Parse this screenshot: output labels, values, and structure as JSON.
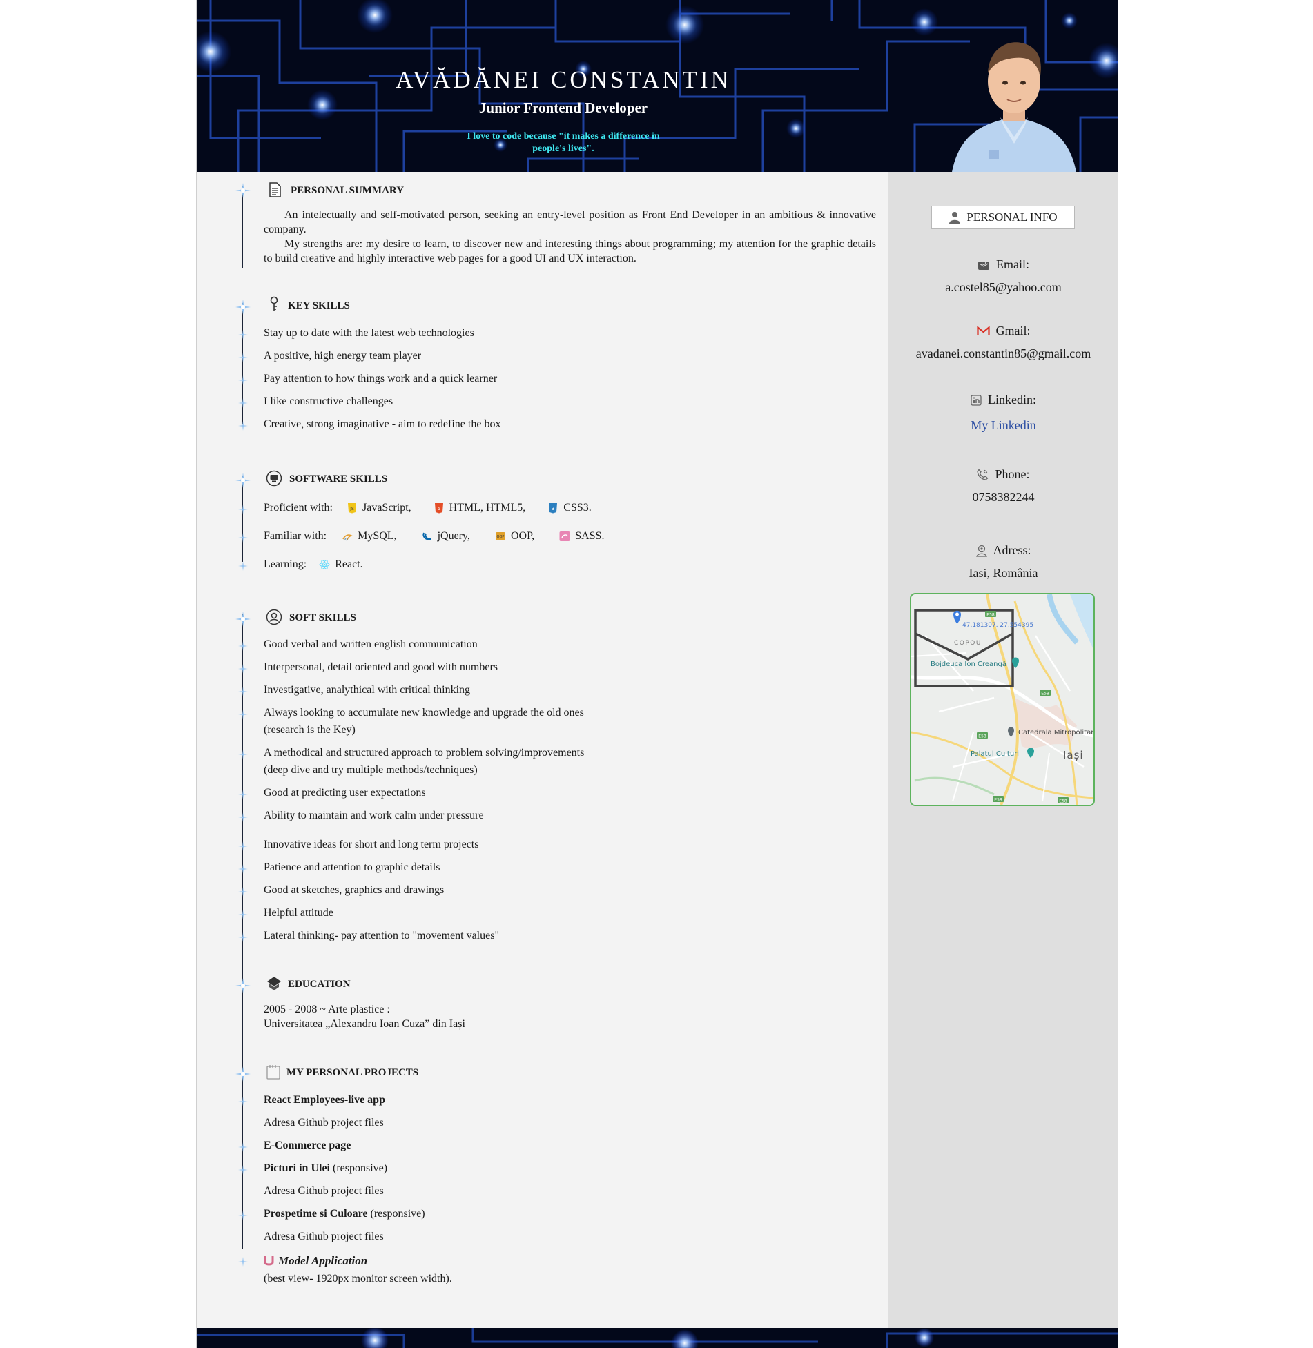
{
  "header": {
    "name": "AVĂDĂNEI CONSTANTIN",
    "role": "Junior Frontend Developer",
    "quote": "I love to code because \"it makes a difference in people's lives\"."
  },
  "summary": {
    "title": "PERSONAL SUMMARY",
    "paragraphs": [
      "An intelectually and self-motivated person, seeking an entry-level position as Front End Developer in an ambitious & innovative company.",
      "My strengths are: my desire to learn, to discover new and interesting things about programming; my attention for the graphic details to build creative and highly interactive web pages for a good UI and UX interaction."
    ]
  },
  "key_skills": {
    "title": "KEY SKILLS",
    "items": [
      "Stay up to date with the latest web technologies",
      "A positive, high energy team player",
      "Pay attention to how things work and a quick learner",
      "I like constructive challenges",
      "Creative, strong imaginative - aim to redefine the box"
    ]
  },
  "software_skills": {
    "title": "SOFTWARE SKILLS",
    "proficient_label": "Proficient with:",
    "proficient": [
      "JavaScript,",
      "HTML, HTML5,",
      "CSS3."
    ],
    "familiar_label": "Familiar with:",
    "familiar": [
      "MySQL,",
      "jQuery,",
      "OOP,",
      "SASS."
    ],
    "learning_label": "Learning:",
    "learning": [
      "React."
    ],
    "icons": {
      "javascript": "js-shield-icon",
      "html": "html5-shield-icon",
      "css": "css3-shield-icon",
      "mysql": "mysql-dolphin-icon",
      "jquery": "jquery-swoosh-icon",
      "oop": "oop-badge-icon",
      "sass": "sass-logo-icon",
      "react": "react-atom-icon"
    }
  },
  "soft_skills": {
    "title": "SOFT SKILLS",
    "items": [
      "Good verbal and written english communication",
      "Interpersonal, detail oriented and good with numbers",
      "Investigative, analythical with critical thinking",
      "Always looking to accumulate new knowledge and upgrade the old ones",
      "(research is the Key)",
      "A methodical and structured approach to problem solving/improvements",
      "(deep dive and try multiple methods/techniques)",
      "Good at predicting user expectations",
      "Ability to maintain and work calm under pressure",
      "Innovative ideas for short and long term projects",
      "Patience and attention to graphic details",
      "Good at sketches, graphics and drawings",
      "Helpful attitude",
      "Lateral thinking- pay attention to \"movement values\""
    ]
  },
  "education": {
    "title": "EDUCATION",
    "line1": "2005 - 2008 ~ Arte plastice :",
    "line2": "Universitatea „Alexandru Ioan Cuza” din Iași"
  },
  "projects": {
    "title": "MY PERSONAL PROJECTS",
    "p1_name": "React Employees-live app",
    "p1_link": "Adresa Github project files",
    "p2_name": "E-Commerce page",
    "p3_name": "Picturi in Ulei",
    "p3_suffix": " (responsive)",
    "p3_link": "Adresa Github project files",
    "p4_name": "Prospetime si Culoare",
    "p4_suffix": " (responsive)",
    "p4_link": "Adresa Github project files",
    "p5_name": "Model Application",
    "p5_note": "(best view- 1920px monitor screen width)."
  },
  "personal_info": {
    "title": "PERSONAL INFO",
    "email_label": "Email:",
    "email": "a.costel85@yahoo.com",
    "gmail_label": "Gmail:",
    "gmail": "avadanei.constantin85@gmail.com",
    "linkedin_label": "Linkedin:",
    "linkedin": "My Linkedin",
    "phone_label": "Phone:",
    "phone": "0758382244",
    "address_label": "Adress:",
    "address": "Iasi, România"
  },
  "map": {
    "coords": "47.181307, 27.554395",
    "labels": [
      "COPOU",
      "Bojdeuca Ion Creangă",
      "Catedrala Mitropolitană",
      "Palatul Culturii",
      "Iași"
    ],
    "road_badge": "E58"
  },
  "colors": {
    "header_bg": "#03081a",
    "quote": "#3fe7f0",
    "link": "#2c4ea3",
    "map_border": "#5db35d"
  }
}
